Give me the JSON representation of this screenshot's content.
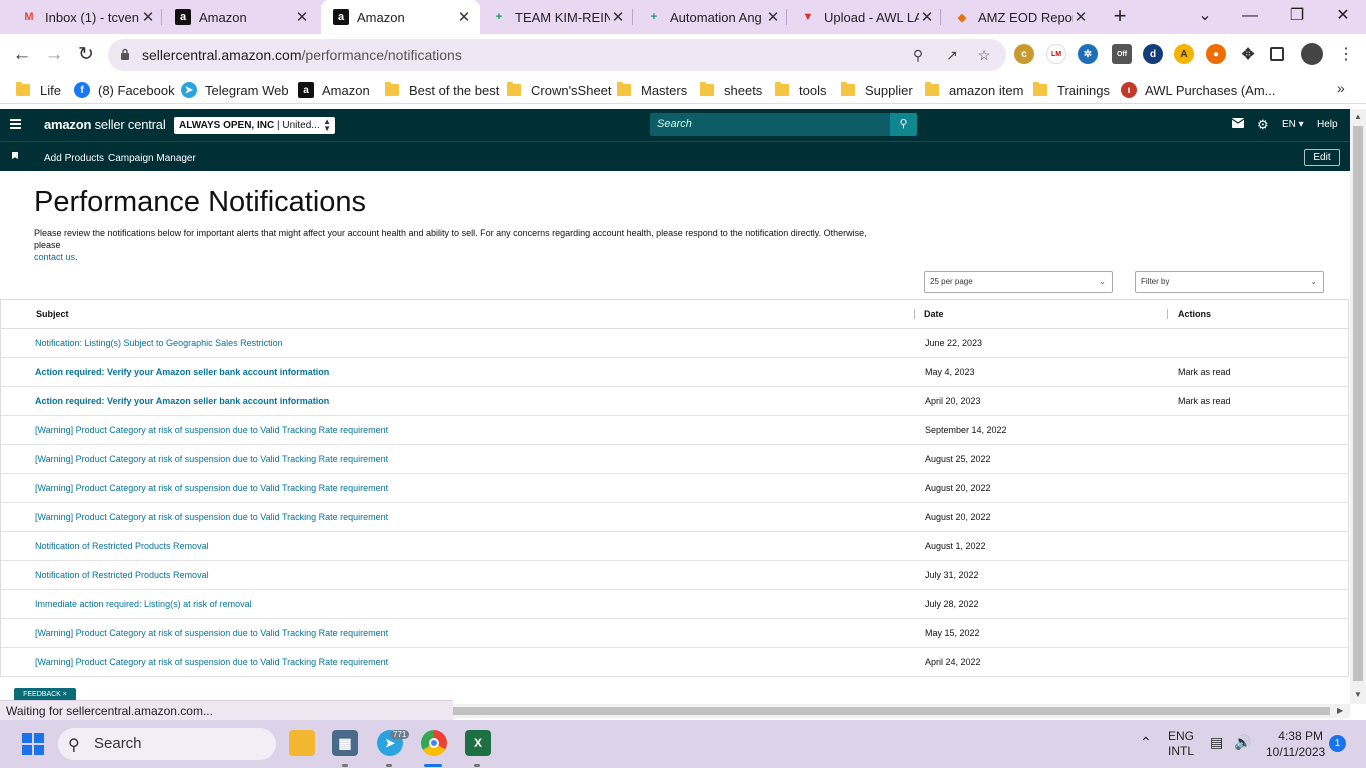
{
  "browser": {
    "tabs": [
      {
        "title": "Inbox (1) - tcven",
        "icon": "gmail-icon",
        "fav": "M",
        "color": "#ea4335",
        "active": false
      },
      {
        "title": "Amazon",
        "icon": "amazon-icon",
        "fav": "a",
        "color": "#111111",
        "active": false
      },
      {
        "title": "Amazon",
        "icon": "amazon-icon",
        "fav": "a",
        "color": "#111111",
        "active": true
      },
      {
        "title": "TEAM KIM-REIN",
        "icon": "sheets-icon",
        "fav": "+",
        "color": "#0f9d58",
        "active": false
      },
      {
        "title": "Automation Ang",
        "icon": "sheets-icon",
        "fav": "+",
        "color": "#0f9d58",
        "active": false
      },
      {
        "title": "Upload - AWL LA",
        "icon": "upload-app-icon",
        "fav": "▼",
        "color": "#d93025",
        "active": false
      },
      {
        "title": "AMZ EOD Repor",
        "icon": "report-app-icon",
        "fav": "◆",
        "color": "#e8710a",
        "active": false
      }
    ],
    "url_host": "sellercentral.amazon.com",
    "url_path": "/performance/notifications",
    "bookmarks": [
      {
        "label": "Life",
        "type": "folder"
      },
      {
        "label": "(8) Facebook",
        "type": "facebook"
      },
      {
        "label": "Telegram Web",
        "type": "telegram"
      },
      {
        "label": "Amazon",
        "type": "amazon"
      },
      {
        "label": "Best of the best",
        "type": "folder"
      },
      {
        "label": "Crown'sSheet",
        "type": "folder"
      },
      {
        "label": "Masters",
        "type": "folder"
      },
      {
        "label": "sheets",
        "type": "folder"
      },
      {
        "label": "tools",
        "type": "folder"
      },
      {
        "label": "Supplier",
        "type": "folder"
      },
      {
        "label": "amazon item",
        "type": "folder"
      },
      {
        "label": "Trainings",
        "type": "folder"
      },
      {
        "label": "AWL Purchases (Am...",
        "type": "awl"
      }
    ],
    "status_text": "Waiting for sellercentral.amazon.com..."
  },
  "seller_central": {
    "logo_brand": "amazon",
    "logo_suffix": " seller central",
    "account_name": "ALWAYS OPEN, INC",
    "account_region": " | United...",
    "search_placeholder": "Search",
    "language": "EN",
    "help": "Help",
    "nav": {
      "add_products": "Add Products",
      "campaign_manager": "Campaign Manager",
      "edit": "Edit"
    }
  },
  "page": {
    "title": "Performance Notifications",
    "intro": "Please review the notifications below for important alerts that might affect your account health and ability to sell. For any concerns regarding account health, please respond to the notification directly. Otherwise, please",
    "intro_link": "contact us",
    "intro_end": ".",
    "per_page": "25 per page",
    "filter_placeholder": "Filter by",
    "columns": {
      "subject": "Subject",
      "date": "Date",
      "actions": "Actions"
    },
    "rows": [
      {
        "subject": "Notification: Listing(s) Subject to Geographic Sales Restriction",
        "date": "June 22, 2023",
        "action": "",
        "bold": false
      },
      {
        "subject": "Action required: Verify your Amazon seller bank account information",
        "date": "May 4, 2023",
        "action": "Mark as read",
        "bold": true
      },
      {
        "subject": "Action required: Verify your Amazon seller bank account information",
        "date": "April 20, 2023",
        "action": "Mark as read",
        "bold": true
      },
      {
        "subject": "[Warning] Product Category at risk of suspension due to Valid Tracking Rate requirement",
        "date": "September 14, 2022",
        "action": "",
        "bold": false
      },
      {
        "subject": "[Warning] Product Category at risk of suspension due to Valid Tracking Rate requirement",
        "date": "August 25, 2022",
        "action": "",
        "bold": false
      },
      {
        "subject": "[Warning] Product Category at risk of suspension due to Valid Tracking Rate requirement",
        "date": "August 20, 2022",
        "action": "",
        "bold": false
      },
      {
        "subject": "[Warning] Product Category at risk of suspension due to Valid Tracking Rate requirement",
        "date": "August 20, 2022",
        "action": "",
        "bold": false
      },
      {
        "subject": "Notification of Restricted Products Removal",
        "date": "August 1, 2022",
        "action": "",
        "bold": false
      },
      {
        "subject": "Notification of Restricted Products Removal",
        "date": "July 31, 2022",
        "action": "",
        "bold": false
      },
      {
        "subject": "Immediate action required: Listing(s) at risk of removal",
        "date": "July 28, 2022",
        "action": "",
        "bold": false
      },
      {
        "subject": "[Warning] Product Category at risk of suspension due to Valid Tracking Rate requirement",
        "date": "May 15, 2022",
        "action": "",
        "bold": false
      },
      {
        "subject": "[Warning] Product Category at risk of suspension due to Valid Tracking Rate requirement",
        "date": "April 24, 2022",
        "action": "",
        "bold": false
      }
    ],
    "feedback": "FEEDBACK ×"
  },
  "taskbar": {
    "search": "Search",
    "telegram_badge": "771",
    "lang_1": "ENG",
    "lang_2": "INTL",
    "time": "4:38 PM",
    "date": "10/11/2023",
    "notifications": "1"
  },
  "colors": {
    "header_bg": "#002f36",
    "link": "#077398",
    "tabstrip": "#e9d8f2"
  }
}
